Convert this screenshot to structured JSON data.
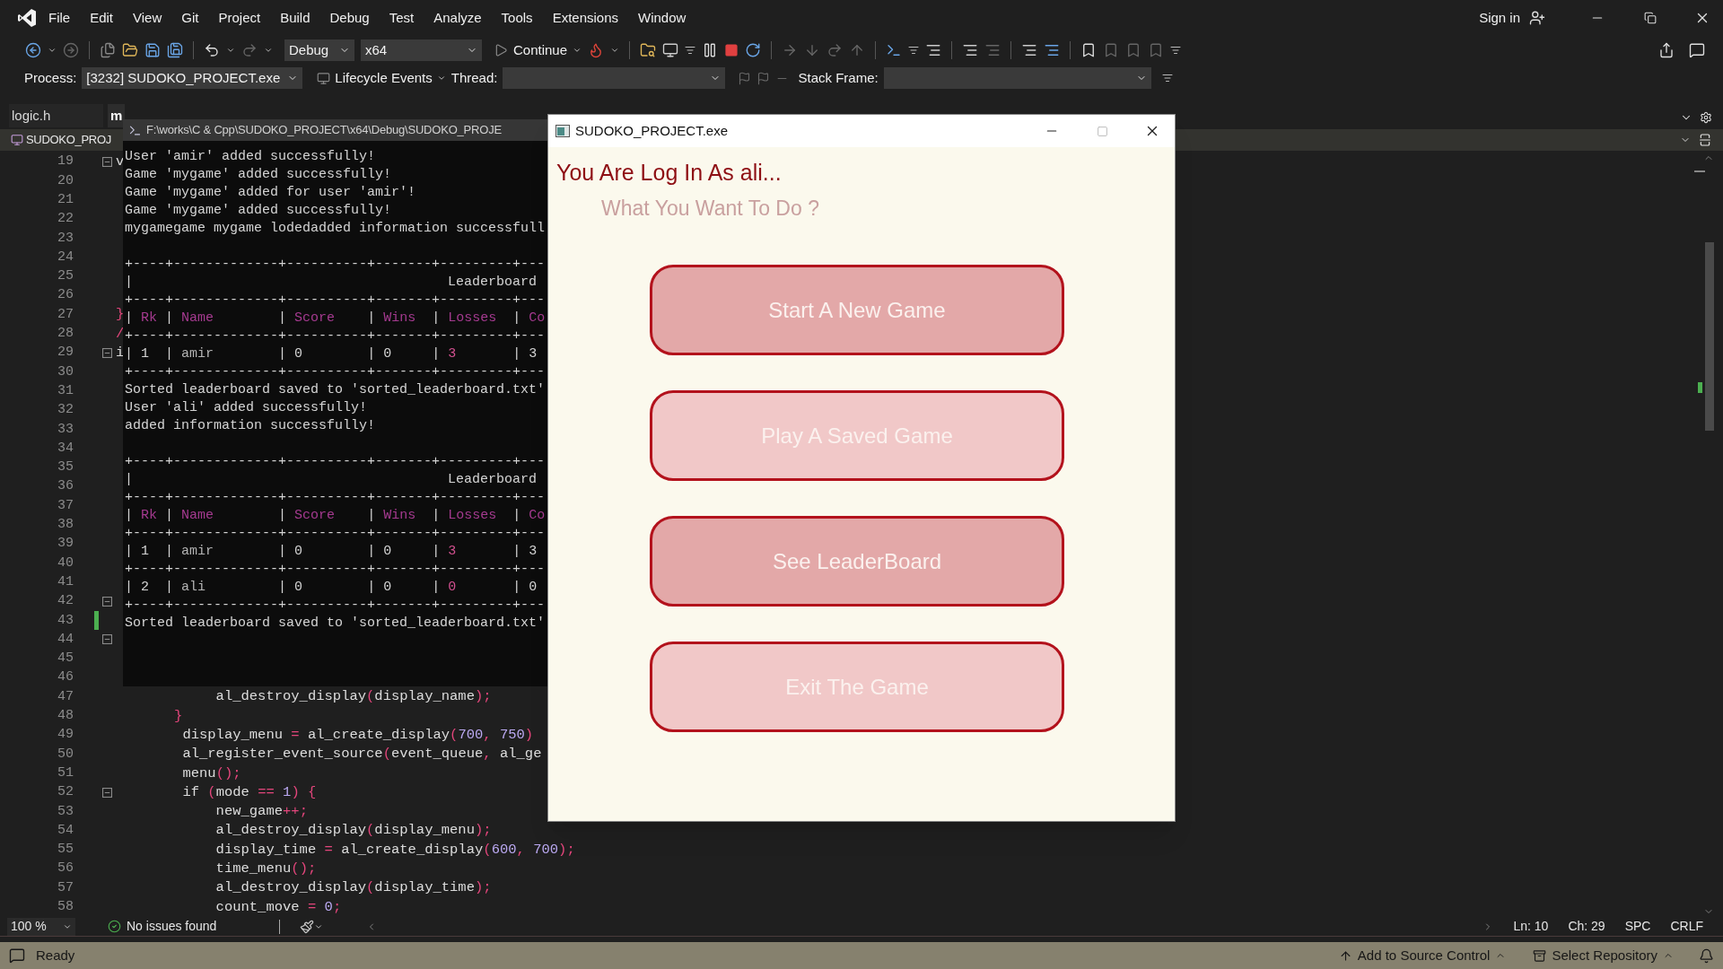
{
  "menu_bar": {
    "items": [
      "File",
      "Edit",
      "View",
      "Git",
      "Project",
      "Build",
      "Debug",
      "Test",
      "Analyze",
      "Tools",
      "Extensions",
      "Window"
    ],
    "sign_in": "Sign in"
  },
  "toolbar": {
    "configuration": "Debug",
    "platform": "x64",
    "continue": "Continue"
  },
  "debug_location": {
    "process_label": "Process:",
    "process": "[3232] SUDOKO_PROJECT.exe",
    "lifecycle": "Lifecycle Events",
    "thread_label": "Thread:",
    "stack_frame_label": "Stack Frame:"
  },
  "tabs": [
    {
      "label": "logic.h",
      "selected": false
    },
    {
      "label": "m",
      "selected": true
    }
  ],
  "navigation": {
    "project": "SUDOKO_PROJ"
  },
  "editor": {
    "lines": [
      {
        "number": "19",
        "code": "v",
        "fold": true,
        "changed": false
      },
      {
        "number": "20",
        "fold": false,
        "changed": false
      },
      {
        "number": "21",
        "fold": false,
        "changed": false
      },
      {
        "number": "22",
        "fold": false,
        "changed": false
      },
      {
        "number": "23",
        "fold": false,
        "changed": false
      },
      {
        "number": "24",
        "fold": false,
        "changed": false
      },
      {
        "number": "25",
        "fold": false,
        "changed": false
      },
      {
        "number": "26",
        "fold": false,
        "changed": false
      },
      {
        "number": "27",
        "code": "}",
        "fold": false,
        "changed": false
      },
      {
        "number": "28",
        "code": "/",
        "fold": false,
        "changed": false
      },
      {
        "number": "29",
        "code": "i",
        "fold": true,
        "changed": false
      },
      {
        "number": "30",
        "fold": false,
        "changed": false
      },
      {
        "number": "31",
        "fold": false,
        "changed": false
      },
      {
        "number": "32",
        "fold": false,
        "changed": false
      },
      {
        "number": "33",
        "fold": false,
        "changed": false
      },
      {
        "number": "34",
        "fold": false,
        "changed": false
      },
      {
        "number": "35",
        "fold": false,
        "changed": false
      },
      {
        "number": "36",
        "fold": false,
        "changed": false
      },
      {
        "number": "37",
        "fold": false,
        "changed": false
      },
      {
        "number": "38",
        "fold": false,
        "changed": false
      },
      {
        "number": "39",
        "fold": false,
        "changed": false
      },
      {
        "number": "40",
        "fold": false,
        "changed": false
      },
      {
        "number": "41",
        "fold": false,
        "changed": false
      },
      {
        "number": "42",
        "fold": true,
        "changed": false
      },
      {
        "number": "43",
        "fold": false,
        "changed": true
      },
      {
        "number": "44",
        "fold": true,
        "changed": false
      },
      {
        "number": "45",
        "fold": false,
        "changed": false
      },
      {
        "number": "46",
        "fold": false,
        "changed": false
      },
      {
        "number": "47",
        "code": "            al_destroy_display(display_name);",
        "fold": false,
        "changed": false
      },
      {
        "number": "48",
        "code": "       }",
        "fold": false,
        "changed": false
      },
      {
        "number": "49",
        "code": "        display_menu = al_create_display(700, 750)",
        "fold": false,
        "changed": false
      },
      {
        "number": "50",
        "code": "        al_register_event_source(event_queue, al_ge",
        "fold": false,
        "changed": false
      },
      {
        "number": "51",
        "code": "        menu();",
        "fold": false,
        "changed": false
      },
      {
        "number": "52",
        "code": "        if (mode == 1) {",
        "fold": true,
        "changed": false
      },
      {
        "number": "53",
        "code": "            new_game++;",
        "fold": false,
        "changed": false
      },
      {
        "number": "54",
        "code": "            al_destroy_display(display_menu);",
        "fold": false,
        "changed": false
      },
      {
        "number": "55",
        "code": "            display_time = al_create_display(600, 700);",
        "fold": false,
        "changed": false
      },
      {
        "number": "56",
        "code": "            time_menu();",
        "fold": false,
        "changed": false
      },
      {
        "number": "57",
        "code": "            al_destroy_display(display_time);",
        "fold": false,
        "changed": false
      },
      {
        "number": "58",
        "code": "            count_move = 0;",
        "fold": false,
        "changed": false
      }
    ]
  },
  "editor_status": {
    "zoom": "100 %",
    "issues": "No issues found",
    "line": "Ln: 10",
    "column": "Ch: 29",
    "whitespace": "SPC",
    "line_ending": "CRLF"
  },
  "status_bar": {
    "state": "Ready",
    "source_control": "Add to Source Control",
    "repository": "Select Repository"
  },
  "console": {
    "title": "F:\\works\\C & Cpp\\SUDOKO_PROJECT\\x64\\Debug\\SUDOKO_PROJE",
    "lines": [
      {
        "kind": "text",
        "text": "User 'amir' added successfully!"
      },
      {
        "kind": "text",
        "text": "Game 'mygame' added successfully!"
      },
      {
        "kind": "text",
        "text": "Game 'mygame' added for user 'amir'!"
      },
      {
        "kind": "text",
        "text": "Game 'mygame' added successfully!"
      },
      {
        "kind": "text",
        "text": "mygamegame mygame lodedadded information successfull"
      },
      {
        "kind": "blank"
      },
      {
        "kind": "text",
        "text": "+----+-------------+----------+-------+---------+---"
      },
      {
        "kind": "text",
        "text": "|                                       Leaderboard"
      },
      {
        "kind": "text",
        "text": "+----+-------------+----------+-------+---------+---"
      },
      {
        "kind": "header",
        "cells": [
          "| Rk ",
          "| Name        ",
          "| Score    ",
          "| Wins  ",
          "| Losses  ",
          "| Co"
        ]
      },
      {
        "kind": "text",
        "text": "+----+-------------+----------+-------+---------+---"
      },
      {
        "kind": "row",
        "cells": [
          "| 1  ",
          "| amir        ",
          "| 0        ",
          "| 0     ",
          "| 3       ",
          "| 3"
        ]
      },
      {
        "kind": "text",
        "text": "+----+-------------+----------+-------+---------+---"
      },
      {
        "kind": "text",
        "text": "Sorted leaderboard saved to 'sorted_leaderboard.txt'"
      },
      {
        "kind": "text",
        "text": "User 'ali' added successfully!"
      },
      {
        "kind": "text",
        "text": "added information successfully!"
      },
      {
        "kind": "blank"
      },
      {
        "kind": "text",
        "text": "+----+-------------+----------+-------+---------+---"
      },
      {
        "kind": "text",
        "text": "|                                       Leaderboard"
      },
      {
        "kind": "text",
        "text": "+----+-------------+----------+-------+---------+---"
      },
      {
        "kind": "header",
        "cells": [
          "| Rk ",
          "| Name        ",
          "| Score    ",
          "| Wins  ",
          "| Losses  ",
          "| Co"
        ]
      },
      {
        "kind": "text",
        "text": "+----+-------------+----------+-------+---------+---"
      },
      {
        "kind": "row",
        "cells": [
          "| 1  ",
          "| amir        ",
          "| 0        ",
          "| 0     ",
          "| 3       ",
          "| 3"
        ]
      },
      {
        "kind": "text",
        "text": "+----+-------------+----------+-------+---------+---"
      },
      {
        "kind": "row",
        "cells": [
          "| 2  ",
          "| ali         ",
          "| 0        ",
          "| 0     ",
          "| 0       ",
          "| 0"
        ]
      },
      {
        "kind": "text",
        "text": "+----+-------------+----------+-------+---------+---"
      },
      {
        "kind": "text",
        "text": "Sorted leaderboard saved to 'sorted_leaderboard.txt'"
      }
    ]
  },
  "game_window": {
    "title": "SUDOKO_PROJECT.exe",
    "greeting": "You Are Log In As ali...",
    "prompt": "What You Want To Do ?",
    "buttons": [
      {
        "label": "Start A New Game",
        "color": "#e3a8a8"
      },
      {
        "label": "Play A Saved Game",
        "color": "#f1c8c8"
      },
      {
        "label": "See LeaderBoard",
        "color": "#e3a8a8"
      },
      {
        "label": "Exit The Game",
        "color": "#f1c8c8"
      }
    ]
  }
}
